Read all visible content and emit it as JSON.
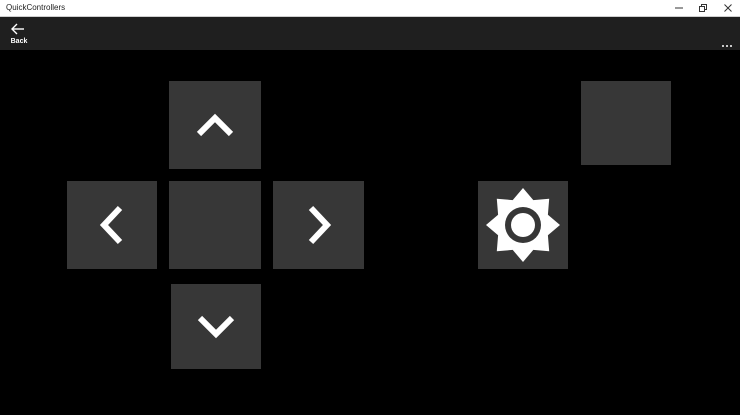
{
  "window": {
    "title": "QuickControllers",
    "controls": {
      "minimize_icon": "minimize-icon",
      "restore_icon": "restore-icon",
      "close_icon": "close-icon"
    }
  },
  "command_bar": {
    "back_label": "Back",
    "back_icon": "arrow-left-icon",
    "more_icon": "more-ellipsis-icon"
  },
  "controller": {
    "dpad": {
      "up_icon": "chevron-up-icon",
      "left_icon": "chevron-left-icon",
      "right_icon": "chevron-right-icon",
      "down_icon": "chevron-down-icon",
      "center": "blank"
    },
    "action_buttons": {
      "top_right": "blank",
      "light_icon": "brightness-icon"
    }
  },
  "colors": {
    "background": "#000000",
    "command_bar": "#1f1f1f",
    "pad": "#373737",
    "icon": "#ffffff",
    "titlebar": "#ffffff"
  }
}
